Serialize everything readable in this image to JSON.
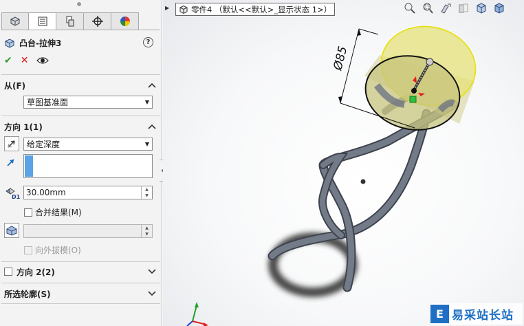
{
  "feature_panel": {
    "title": "凸台-拉伸3",
    "help_label": "?",
    "tabs": [
      "feature-manager",
      "property-manager",
      "configuration-manager",
      "dimxpert-manager",
      "display-manager"
    ],
    "from_section": {
      "label": "从(F)",
      "start_condition": "草图基准面"
    },
    "direction1_section": {
      "label": "方向 1(1)",
      "end_condition": "给定深度",
      "depth_value": "30.00mm",
      "merge_result_label": "合并结果(M)",
      "merge_result_checked": false,
      "draft_outward_label": "向外拔模(O)",
      "draft_outward_enabled": false
    },
    "direction2_section": {
      "label": "方向 2(2)",
      "checked": false
    },
    "selected_contours_section": {
      "label": "所选轮廓(S)"
    }
  },
  "viewport": {
    "breadcrumb": "零件4 （默认<<默认>_显示状态 1>）",
    "dimension_label": "Ø85",
    "heads_up_toolbar": [
      "zoom-to-fit-icon",
      "zoom-to-area-icon",
      "previous-view-icon",
      "section-view-icon",
      "view-orientation-icon",
      "display-style-icon"
    ]
  },
  "watermark": {
    "logo": "E",
    "text": "易采站长站"
  },
  "colors": {
    "preview_fill": "#e6e27a",
    "preview_edge": "#e8e000",
    "helix": "#6f7583",
    "selection_blue": "#5aa3e6"
  }
}
